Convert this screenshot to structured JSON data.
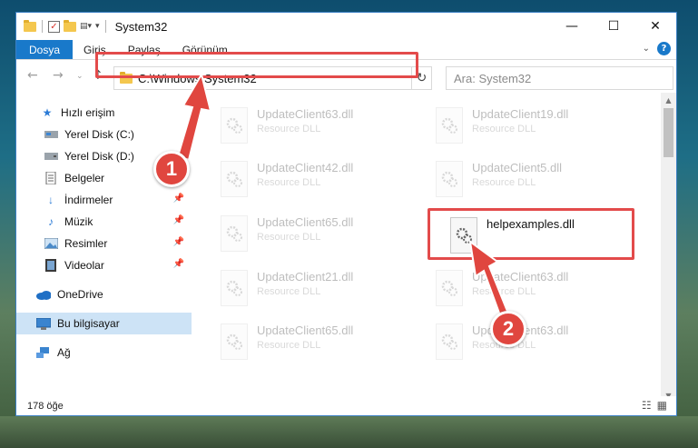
{
  "window": {
    "title": "System32",
    "min": "—",
    "max": "☐",
    "close": "✕"
  },
  "ribbon": {
    "tabs": [
      "Dosya",
      "Giriş",
      "Paylaş",
      "Görünüm"
    ],
    "help": "?"
  },
  "address": {
    "path": "C:\\Windows\\System32",
    "search_placeholder": "Ara: System32"
  },
  "sidebar": {
    "items": [
      {
        "label": "Hızlı erişim",
        "icon": "star-icon"
      },
      {
        "label": "Yerel Disk (C:)",
        "icon": "drive-icon"
      },
      {
        "label": "Yerel Disk (D:)",
        "icon": "drive-icon"
      },
      {
        "label": "Belgeler",
        "icon": "documents-icon"
      },
      {
        "label": "İndirmeler",
        "icon": "download-icon"
      },
      {
        "label": "Müzik",
        "icon": "music-icon"
      },
      {
        "label": "Resimler",
        "icon": "pictures-icon"
      },
      {
        "label": "Videolar",
        "icon": "video-icon"
      },
      {
        "label": "OneDrive",
        "icon": "cloud-icon"
      },
      {
        "label": "Bu bilgisayar",
        "icon": "computer-icon"
      },
      {
        "label": "Ağ",
        "icon": "network-icon"
      }
    ]
  },
  "files": [
    {
      "name": "UpdateClient63.dll",
      "type": "Resource DLL"
    },
    {
      "name": "UpdateClient19.dll",
      "type": "Resource DLL"
    },
    {
      "name": "UpdateClient42.dll",
      "type": "Resource DLL"
    },
    {
      "name": "UpdateClient5.dll",
      "type": "Resource DLL"
    },
    {
      "name": "UpdateClient65.dll",
      "type": "Resource DLL"
    },
    {
      "name": "helpexamples.dll",
      "type": ""
    },
    {
      "name": "UpdateClient21.dll",
      "type": "Resource DLL"
    },
    {
      "name": "UpdateClient63.dll",
      "type": "Resource DLL"
    },
    {
      "name": "UpdateClient65.dll",
      "type": "Resource DLL"
    },
    {
      "name": "UpdateClient63.dll",
      "type": "Resource DLL"
    }
  ],
  "status": {
    "count": "178 öğe"
  },
  "annotations": {
    "step1": "1",
    "step2": "2",
    "color": "#e0463f"
  }
}
